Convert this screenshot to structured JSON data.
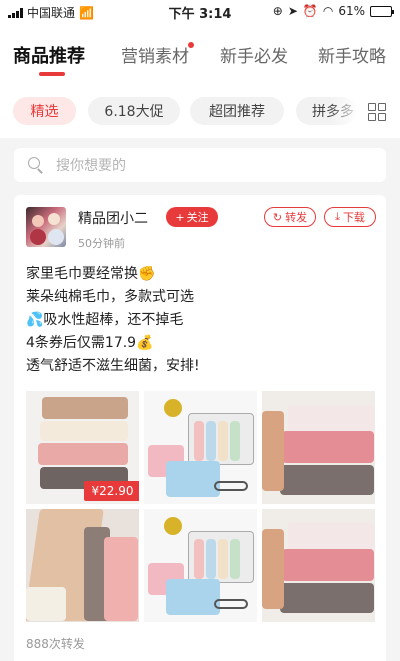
{
  "status_bar": {
    "carrier": "中国联通",
    "time": "下午 3:14",
    "battery": "61%",
    "battery_level": 0.61
  },
  "tabs": [
    {
      "label": "商品推荐",
      "active": true
    },
    {
      "label": "营销素材",
      "active": false,
      "has_dot": true
    },
    {
      "label": "新手必发",
      "active": false
    },
    {
      "label": "新手攻略",
      "active": false
    }
  ],
  "chips": [
    {
      "label": "精选",
      "active": true
    },
    {
      "label": "6.18大促",
      "active": false
    },
    {
      "label": "超团推荐",
      "active": false
    },
    {
      "label": "拼多多",
      "active": false
    }
  ],
  "search": {
    "placeholder": "搜你想要的"
  },
  "post": {
    "author": "精品团小二",
    "follow_label": "关注",
    "time": "50分钟前",
    "forward_label": "转发",
    "download_label": "下载",
    "text_lines": [
      "家里毛巾要经常换✊",
      "莱朵纯棉毛巾，多款式可选",
      "💦吸水性超棒，还不掉毛",
      "4条券后仅需17.9💰",
      "透气舒适不滋生细菌，安排!"
    ],
    "price": "¥22.90",
    "forward_count": "888次转发"
  },
  "colors": {
    "accent": "#e83a3a",
    "chip_active_bg": "#fde7e7"
  }
}
